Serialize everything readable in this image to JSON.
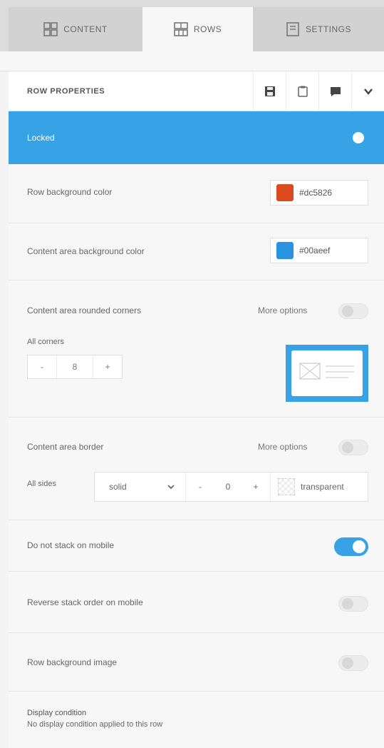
{
  "tabs": [
    {
      "label": "CONTENT",
      "icon": "content-grid-icon"
    },
    {
      "label": "ROWS",
      "icon": "rows-grid-icon",
      "active": true
    },
    {
      "label": "SETTINGS",
      "icon": "settings-panel-icon"
    }
  ],
  "header": {
    "title": "ROW PROPERTIES",
    "icons": [
      "save-icon",
      "clipboard-icon",
      "comment-icon",
      "chevron-down-icon"
    ]
  },
  "locked": {
    "label": "Locked",
    "on": true
  },
  "row_bg": {
    "label": "Row background color",
    "value": "#dc5826",
    "swatch": "#dc4a20"
  },
  "content_bg": {
    "label": "Content area background color",
    "value": "#00aeef",
    "swatch": "#2a93e0"
  },
  "corners": {
    "label": "Content area rounded corners",
    "more_options": "More options",
    "sub_label": "All corners",
    "minus": "-",
    "value": "8",
    "plus": "+"
  },
  "border": {
    "label": "Content area border",
    "more_options": "More options",
    "sub_label": "All sides",
    "style": "solid",
    "minus": "-",
    "width": "0",
    "plus": "+",
    "color": "transparent"
  },
  "no_stack": {
    "label": "Do not stack on mobile",
    "on": true
  },
  "reverse_stack": {
    "label": "Reverse stack order on mobile",
    "on": false
  },
  "row_bg_image": {
    "label": "Row background image",
    "on": false
  },
  "display_condition": {
    "label": "Display condition",
    "description": "No display condition applied to this row"
  },
  "colors": {
    "accent": "#37a3e6"
  }
}
